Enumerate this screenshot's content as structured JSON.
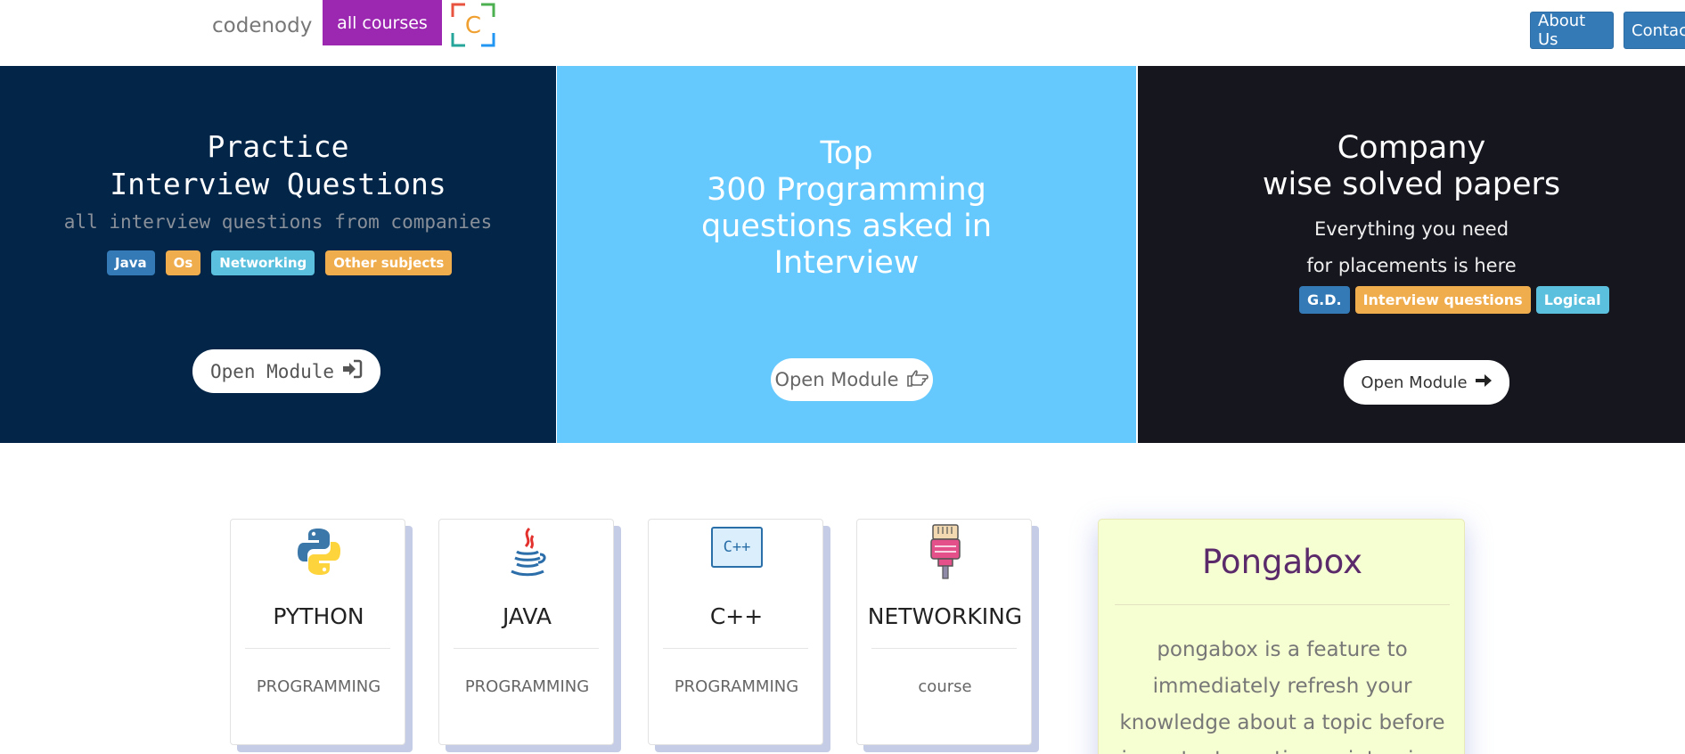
{
  "navbar": {
    "brand": "codenody",
    "all_courses": "all courses",
    "logo_letter": "C",
    "about": "About Us",
    "contact": "Contact"
  },
  "hero": {
    "panel1": {
      "title_line1": "Practice",
      "title_line2": "Interview Questions",
      "subtitle": "all interview questions from companies",
      "tags": [
        "Java",
        "Os",
        "Networking",
        "Other subjects"
      ],
      "button": "Open Module",
      "bg": "#022548"
    },
    "panel2": {
      "title_line1": "Top",
      "title_line2": "300 Programming",
      "title_line3": "questions asked in",
      "title_line4": "Interview",
      "button": "Open Module",
      "bg": "#66c9fd"
    },
    "panel3": {
      "title_line1": "Company",
      "title_line2": "wise solved papers",
      "sub_line1": "Everything you need",
      "sub_line2": "for placements is here",
      "tags": [
        "G.D.",
        "Interview questions",
        "Logical"
      ],
      "button": "Open Module",
      "bg": "#16161f"
    }
  },
  "courses": [
    {
      "name": "PYTHON",
      "type": "PROGRAMMING",
      "icon": "python-icon"
    },
    {
      "name": "JAVA",
      "type": "PROGRAMMING",
      "icon": "java-icon"
    },
    {
      "name": "C++",
      "type": "PROGRAMMING",
      "icon": "cpp-icon",
      "icon_text": "C++"
    },
    {
      "name": "NETWORKING",
      "type": "course",
      "icon": "ethernet-cable-icon"
    }
  ],
  "pongabox": {
    "title": "Pongabox",
    "description": "pongabox is a feature to immediately refresh your knowledge about a topic before important meeting or interview"
  },
  "colors": {
    "accent_purple": "#9c27b0",
    "nav_blue": "#337ab7",
    "tag_orange": "#f0ad4e",
    "tag_cyan": "#5bc0de"
  }
}
